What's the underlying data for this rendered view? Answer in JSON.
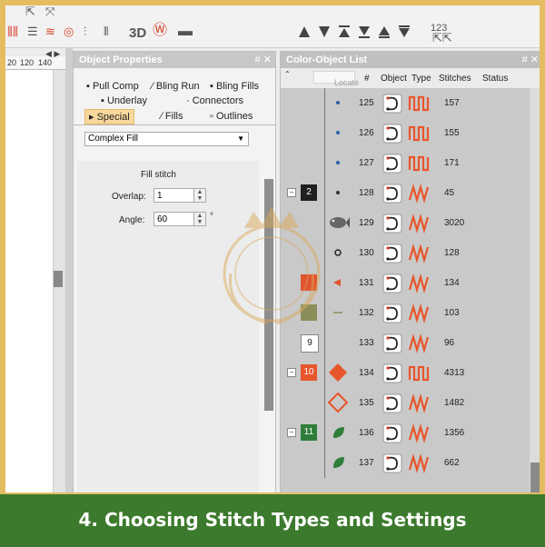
{
  "toolbar": {
    "label_3d": "3D",
    "label_123": "123"
  },
  "ruler": {
    "ticks": [
      "20",
      "120",
      "140"
    ]
  },
  "object_properties": {
    "title": "Object Properties",
    "controls": "# ✕",
    "tabs": [
      {
        "label": "Pull Comp"
      },
      {
        "label": "Bling Run"
      },
      {
        "label": "Bling Fills"
      },
      {
        "label": "Underlay"
      },
      {
        "label": "Connectors"
      },
      {
        "label": "Special",
        "active": true
      },
      {
        "label": "Fills"
      },
      {
        "label": "Outlines"
      }
    ],
    "fill_type": "Complex Fill",
    "section_title": "Fill stitch",
    "overlap_label": "Overlap:",
    "overlap_value": "1",
    "angle_label": "Angle:",
    "angle_value": "60",
    "angle_unit": "°"
  },
  "color_object_list": {
    "title": "Color-Object List",
    "controls": "# ✕",
    "locate_placeholder": "Locate",
    "columns": [
      "#",
      "Object",
      "Type",
      "Stitches",
      "Status"
    ],
    "rows": [
      {
        "num": "125",
        "stitches": "157",
        "swatch": "",
        "color": ""
      },
      {
        "num": "126",
        "stitches": "155",
        "swatch": "",
        "color": ""
      },
      {
        "num": "127",
        "stitches": "171",
        "swatch": "",
        "color": ""
      },
      {
        "num": "128",
        "stitches": "45",
        "swatch": "2",
        "color": "#1f1f1f"
      },
      {
        "num": "129",
        "stitches": "3020",
        "swatch": "",
        "color": ""
      },
      {
        "num": "130",
        "stitches": "128",
        "swatch": "",
        "color": ""
      },
      {
        "num": "131",
        "stitches": "134",
        "swatch": "",
        "color": "#e0542e"
      },
      {
        "num": "132",
        "stitches": "103",
        "swatch": "",
        "color": "#8a8f5a"
      },
      {
        "num": "133",
        "stitches": "96",
        "swatch": "9",
        "color": "#ffffff"
      },
      {
        "num": "134",
        "stitches": "4313",
        "swatch": "10",
        "color": "#e8552c"
      },
      {
        "num": "135",
        "stitches": "1482",
        "swatch": "",
        "color": ""
      },
      {
        "num": "136",
        "stitches": "1356",
        "swatch": "11",
        "color": "#2f7d3a"
      },
      {
        "num": "137",
        "stitches": "662",
        "swatch": "",
        "color": ""
      }
    ]
  },
  "caption": "4. Choosing Stitch Types and Settings",
  "colors": {
    "accent": "#e8552c",
    "caption_bg": "#3c7a2d",
    "frame": "#e4bd62"
  }
}
